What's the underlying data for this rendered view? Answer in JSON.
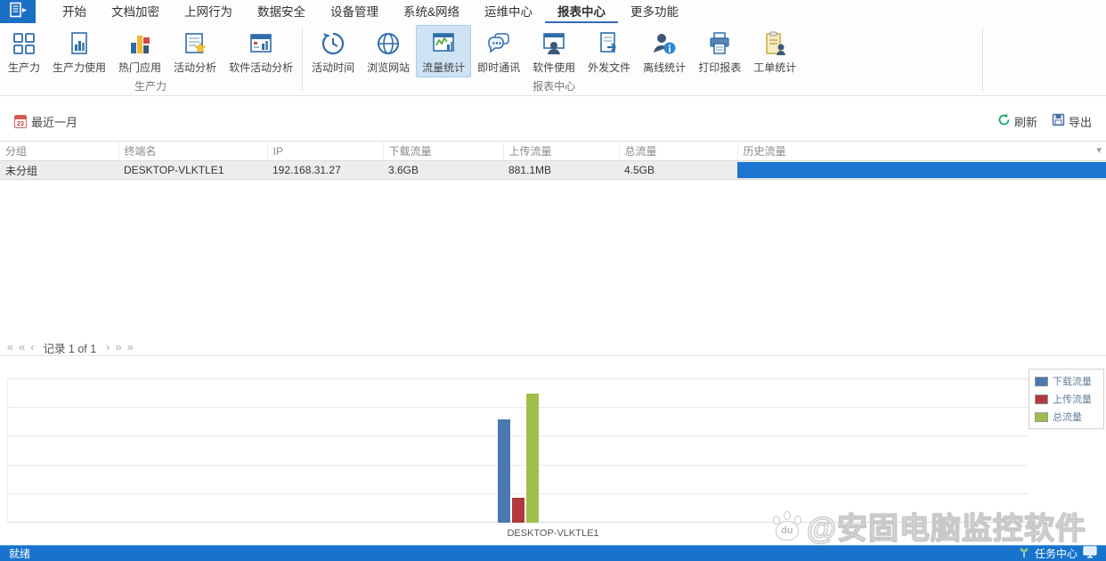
{
  "menu": {
    "tabs": [
      {
        "label": "开始"
      },
      {
        "label": "文档加密"
      },
      {
        "label": "上网行为"
      },
      {
        "label": "数据安全"
      },
      {
        "label": "设备管理"
      },
      {
        "label": "系统&网络"
      },
      {
        "label": "运维中心"
      },
      {
        "label": "报表中心"
      },
      {
        "label": "更多功能"
      }
    ],
    "active_tab": "报表中心"
  },
  "ribbon": {
    "groups": [
      {
        "label": "生产力",
        "buttons": [
          {
            "label": "生产力"
          },
          {
            "label": "生产力使用"
          },
          {
            "label": "热门应用"
          },
          {
            "label": "活动分析"
          },
          {
            "label": "软件活动分析"
          }
        ]
      },
      {
        "label": "报表中心",
        "buttons": [
          {
            "label": "活动时间"
          },
          {
            "label": "浏览网站"
          },
          {
            "label": "流量统计",
            "selected": true
          },
          {
            "label": "即时通讯"
          },
          {
            "label": "软件使用"
          },
          {
            "label": "外发文件"
          },
          {
            "label": "离线统计"
          },
          {
            "label": "打印报表"
          },
          {
            "label": "工单统计"
          }
        ]
      }
    ]
  },
  "toolbar": {
    "date_filter": "最近一月",
    "calendar_day": "23",
    "refresh": "刷新",
    "export": "导出"
  },
  "table": {
    "columns": [
      "分组",
      "终端名",
      "IP",
      "下载流量",
      "上传流量",
      "总流量",
      "历史流量"
    ],
    "rows": [
      {
        "group": "未分组",
        "terminal": "DESKTOP-VLKTLE1",
        "ip": "192.168.31.27",
        "download": "3.6GB",
        "upload": "881.1MB",
        "total": "4.5GB",
        "history_percent": 100
      }
    ]
  },
  "pager": {
    "first": "«",
    "prev_page": "‹‹",
    "prev": "‹",
    "label": "记录 1 of 1",
    "next": "›",
    "next_page": "››",
    "last": "»"
  },
  "chart_data": {
    "type": "bar",
    "title": "",
    "categories": [
      "DESKTOP-VLKTLE1"
    ],
    "series": [
      {
        "name": "下载流量",
        "values": [
          3.6
        ],
        "color": "#4b79ae"
      },
      {
        "name": "上传流量",
        "values": [
          0.86
        ],
        "color": "#b2383f"
      },
      {
        "name": "总流量",
        "values": [
          4.5
        ],
        "color": "#a0bf4a"
      }
    ],
    "unit": "GB",
    "ylim": [
      0,
      5
    ],
    "gridline_step": 1,
    "grid": true,
    "axis_tick_labels_visible": false,
    "legend_position": "top-right"
  },
  "watermark": {
    "handle": "@安固电脑监控软件",
    "logo": "du"
  },
  "status_bar": {
    "left": "就绪",
    "task_center": "任务中心"
  },
  "colors": {
    "accent": "#1b75d1",
    "status_bar": "#1773cc",
    "selected_button_bg": "#cfe3f5",
    "history_bar": "#1b75d1"
  }
}
